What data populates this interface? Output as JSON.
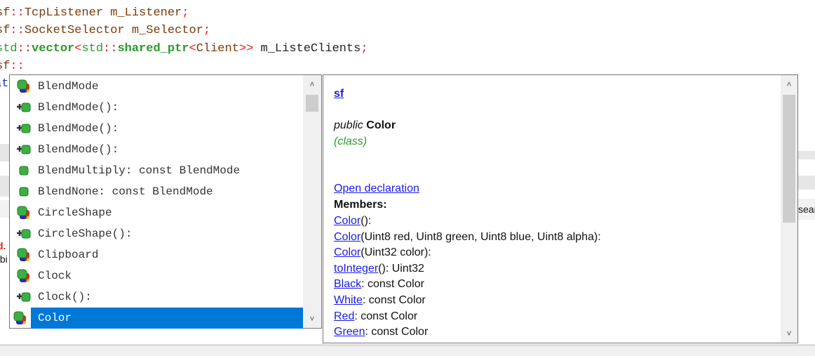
{
  "code_lines": [
    {
      "ns": "sf",
      "sep": "::",
      "rest": "TcpListener m_Listener",
      "end": ";"
    },
    {
      "ns": "sf",
      "sep": "::",
      "rest": "SocketSelector m_Selector",
      "end": ";"
    },
    {
      "a": "std",
      "b": "::",
      "c": "vector",
      "d": "<",
      "e": "std",
      "f": "::",
      "g": "shared_ptr",
      "h": "<",
      "i": "Client",
      ">>": ">>",
      "j": " m_ListeClients",
      "end": ";"
    },
    {
      "ns": "sf",
      "sep": "::"
    }
  ],
  "background_fragments": {
    "left_line": "at",
    "red_text": "d.",
    "path_text": "/bi",
    "right_tab": "sear"
  },
  "autocomplete": {
    "items": [
      {
        "label": "BlendMode",
        "icon": "class-icon"
      },
      {
        "label": "BlendMode():",
        "icon": "constructor-icon"
      },
      {
        "label": "BlendMode():",
        "icon": "constructor-icon"
      },
      {
        "label": "BlendMode():",
        "icon": "constructor-icon"
      },
      {
        "label": "BlendMultiply: const BlendMode",
        "icon": "variable-icon"
      },
      {
        "label": "BlendNone: const BlendMode",
        "icon": "variable-icon"
      },
      {
        "label": "CircleShape",
        "icon": "class-icon"
      },
      {
        "label": "CircleShape():",
        "icon": "constructor-icon"
      },
      {
        "label": "Clipboard",
        "icon": "class-icon"
      },
      {
        "label": "Clock",
        "icon": "class-icon"
      },
      {
        "label": "Clock():",
        "icon": "constructor-icon"
      },
      {
        "label": "Color",
        "icon": "class-icon",
        "selected": true
      }
    ]
  },
  "doc": {
    "namespace": "sf",
    "visibility": "public",
    "name": "Color",
    "kind": "(class)",
    "open_decl": "Open declaration",
    "members_label": "Members:",
    "members": [
      {
        "link": "Color",
        "rest": "():"
      },
      {
        "link": "Color",
        "rest": "(Uint8 red, Uint8 green, Uint8 blue, Uint8 alpha):"
      },
      {
        "link": "Color",
        "rest": "(Uint32 color):"
      },
      {
        "link": "toInteger",
        "rest": "(): Uint32"
      },
      {
        "link": "Black",
        "rest": ": const Color"
      },
      {
        "link": "White",
        "rest": ": const Color"
      },
      {
        "link": "Red",
        "rest": ": const Color"
      },
      {
        "link": "Green",
        "rest": ": const Color"
      }
    ]
  },
  "colors": {
    "selection": "#0078d7",
    "link": "#1a1ae6",
    "kind": "#2a9a2a"
  }
}
